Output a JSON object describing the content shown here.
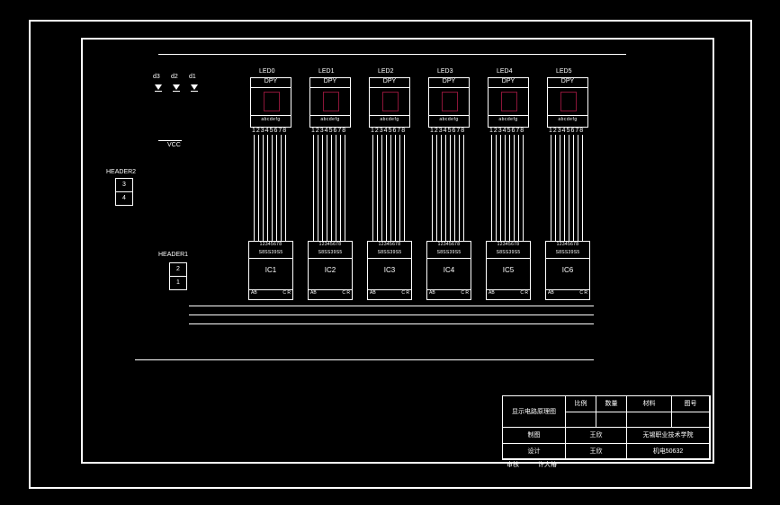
{
  "leds": [
    "LED0",
    "LED1",
    "LED2",
    "LED3",
    "LED4",
    "LED5"
  ],
  "dpy": {
    "label": "DPY",
    "segs": "abcdefg",
    "pins_text": "a-p"
  },
  "dpy_pinrow": "12345678",
  "ics": [
    "IC1",
    "IC2",
    "IC3",
    "IC4",
    "IC5",
    "IC6"
  ],
  "ic_pintop": "12345678",
  "ic_pinnums": "S8SS39S5",
  "ic_botL": "AB",
  "ic_botR": "C R",
  "diodes": [
    "d3",
    "d2",
    "d1"
  ],
  "vcc": "VCC",
  "headers": {
    "h2": "HEADER2",
    "h1": "HEADER1",
    "pins2": [
      "3",
      "4"
    ],
    "pins1": [
      "2",
      "1"
    ]
  },
  "titleblock": {
    "drawing_title": "显示电路原理图",
    "col_headers": [
      "比例",
      "数量",
      "材料",
      "图号"
    ],
    "rows": [
      {
        "role": "制图",
        "name": "王欣"
      },
      {
        "role": "设计",
        "name": "王欣"
      },
      {
        "role": "审核",
        "name": "许大椿"
      }
    ],
    "institution": "无锡职业技术学院",
    "class_id": "机电50632"
  }
}
